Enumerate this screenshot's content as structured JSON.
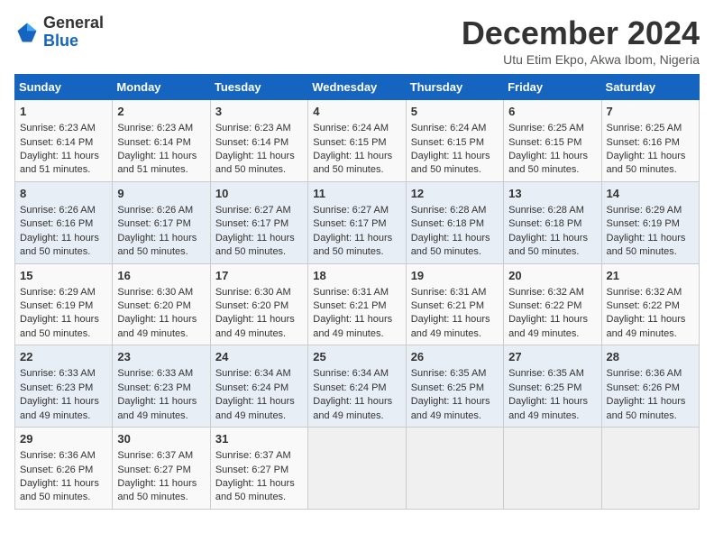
{
  "header": {
    "logo_general": "General",
    "logo_blue": "Blue",
    "month_title": "December 2024",
    "location": "Utu Etim Ekpo, Akwa Ibom, Nigeria"
  },
  "days_of_week": [
    "Sunday",
    "Monday",
    "Tuesday",
    "Wednesday",
    "Thursday",
    "Friday",
    "Saturday"
  ],
  "weeks": [
    [
      {
        "day": "1",
        "sunrise": "Sunrise: 6:23 AM",
        "sunset": "Sunset: 6:14 PM",
        "daylight": "Daylight: 11 hours and 51 minutes."
      },
      {
        "day": "2",
        "sunrise": "Sunrise: 6:23 AM",
        "sunset": "Sunset: 6:14 PM",
        "daylight": "Daylight: 11 hours and 51 minutes."
      },
      {
        "day": "3",
        "sunrise": "Sunrise: 6:23 AM",
        "sunset": "Sunset: 6:14 PM",
        "daylight": "Daylight: 11 hours and 50 minutes."
      },
      {
        "day": "4",
        "sunrise": "Sunrise: 6:24 AM",
        "sunset": "Sunset: 6:15 PM",
        "daylight": "Daylight: 11 hours and 50 minutes."
      },
      {
        "day": "5",
        "sunrise": "Sunrise: 6:24 AM",
        "sunset": "Sunset: 6:15 PM",
        "daylight": "Daylight: 11 hours and 50 minutes."
      },
      {
        "day": "6",
        "sunrise": "Sunrise: 6:25 AM",
        "sunset": "Sunset: 6:15 PM",
        "daylight": "Daylight: 11 hours and 50 minutes."
      },
      {
        "day": "7",
        "sunrise": "Sunrise: 6:25 AM",
        "sunset": "Sunset: 6:16 PM",
        "daylight": "Daylight: 11 hours and 50 minutes."
      }
    ],
    [
      {
        "day": "8",
        "sunrise": "Sunrise: 6:26 AM",
        "sunset": "Sunset: 6:16 PM",
        "daylight": "Daylight: 11 hours and 50 minutes."
      },
      {
        "day": "9",
        "sunrise": "Sunrise: 6:26 AM",
        "sunset": "Sunset: 6:17 PM",
        "daylight": "Daylight: 11 hours and 50 minutes."
      },
      {
        "day": "10",
        "sunrise": "Sunrise: 6:27 AM",
        "sunset": "Sunset: 6:17 PM",
        "daylight": "Daylight: 11 hours and 50 minutes."
      },
      {
        "day": "11",
        "sunrise": "Sunrise: 6:27 AM",
        "sunset": "Sunset: 6:17 PM",
        "daylight": "Daylight: 11 hours and 50 minutes."
      },
      {
        "day": "12",
        "sunrise": "Sunrise: 6:28 AM",
        "sunset": "Sunset: 6:18 PM",
        "daylight": "Daylight: 11 hours and 50 minutes."
      },
      {
        "day": "13",
        "sunrise": "Sunrise: 6:28 AM",
        "sunset": "Sunset: 6:18 PM",
        "daylight": "Daylight: 11 hours and 50 minutes."
      },
      {
        "day": "14",
        "sunrise": "Sunrise: 6:29 AM",
        "sunset": "Sunset: 6:19 PM",
        "daylight": "Daylight: 11 hours and 50 minutes."
      }
    ],
    [
      {
        "day": "15",
        "sunrise": "Sunrise: 6:29 AM",
        "sunset": "Sunset: 6:19 PM",
        "daylight": "Daylight: 11 hours and 50 minutes."
      },
      {
        "day": "16",
        "sunrise": "Sunrise: 6:30 AM",
        "sunset": "Sunset: 6:20 PM",
        "daylight": "Daylight: 11 hours and 49 minutes."
      },
      {
        "day": "17",
        "sunrise": "Sunrise: 6:30 AM",
        "sunset": "Sunset: 6:20 PM",
        "daylight": "Daylight: 11 hours and 49 minutes."
      },
      {
        "day": "18",
        "sunrise": "Sunrise: 6:31 AM",
        "sunset": "Sunset: 6:21 PM",
        "daylight": "Daylight: 11 hours and 49 minutes."
      },
      {
        "day": "19",
        "sunrise": "Sunrise: 6:31 AM",
        "sunset": "Sunset: 6:21 PM",
        "daylight": "Daylight: 11 hours and 49 minutes."
      },
      {
        "day": "20",
        "sunrise": "Sunrise: 6:32 AM",
        "sunset": "Sunset: 6:22 PM",
        "daylight": "Daylight: 11 hours and 49 minutes."
      },
      {
        "day": "21",
        "sunrise": "Sunrise: 6:32 AM",
        "sunset": "Sunset: 6:22 PM",
        "daylight": "Daylight: 11 hours and 49 minutes."
      }
    ],
    [
      {
        "day": "22",
        "sunrise": "Sunrise: 6:33 AM",
        "sunset": "Sunset: 6:23 PM",
        "daylight": "Daylight: 11 hours and 49 minutes."
      },
      {
        "day": "23",
        "sunrise": "Sunrise: 6:33 AM",
        "sunset": "Sunset: 6:23 PM",
        "daylight": "Daylight: 11 hours and 49 minutes."
      },
      {
        "day": "24",
        "sunrise": "Sunrise: 6:34 AM",
        "sunset": "Sunset: 6:24 PM",
        "daylight": "Daylight: 11 hours and 49 minutes."
      },
      {
        "day": "25",
        "sunrise": "Sunrise: 6:34 AM",
        "sunset": "Sunset: 6:24 PM",
        "daylight": "Daylight: 11 hours and 49 minutes."
      },
      {
        "day": "26",
        "sunrise": "Sunrise: 6:35 AM",
        "sunset": "Sunset: 6:25 PM",
        "daylight": "Daylight: 11 hours and 49 minutes."
      },
      {
        "day": "27",
        "sunrise": "Sunrise: 6:35 AM",
        "sunset": "Sunset: 6:25 PM",
        "daylight": "Daylight: 11 hours and 49 minutes."
      },
      {
        "day": "28",
        "sunrise": "Sunrise: 6:36 AM",
        "sunset": "Sunset: 6:26 PM",
        "daylight": "Daylight: 11 hours and 50 minutes."
      }
    ],
    [
      {
        "day": "29",
        "sunrise": "Sunrise: 6:36 AM",
        "sunset": "Sunset: 6:26 PM",
        "daylight": "Daylight: 11 hours and 50 minutes."
      },
      {
        "day": "30",
        "sunrise": "Sunrise: 6:37 AM",
        "sunset": "Sunset: 6:27 PM",
        "daylight": "Daylight: 11 hours and 50 minutes."
      },
      {
        "day": "31",
        "sunrise": "Sunrise: 6:37 AM",
        "sunset": "Sunset: 6:27 PM",
        "daylight": "Daylight: 11 hours and 50 minutes."
      },
      null,
      null,
      null,
      null
    ]
  ]
}
